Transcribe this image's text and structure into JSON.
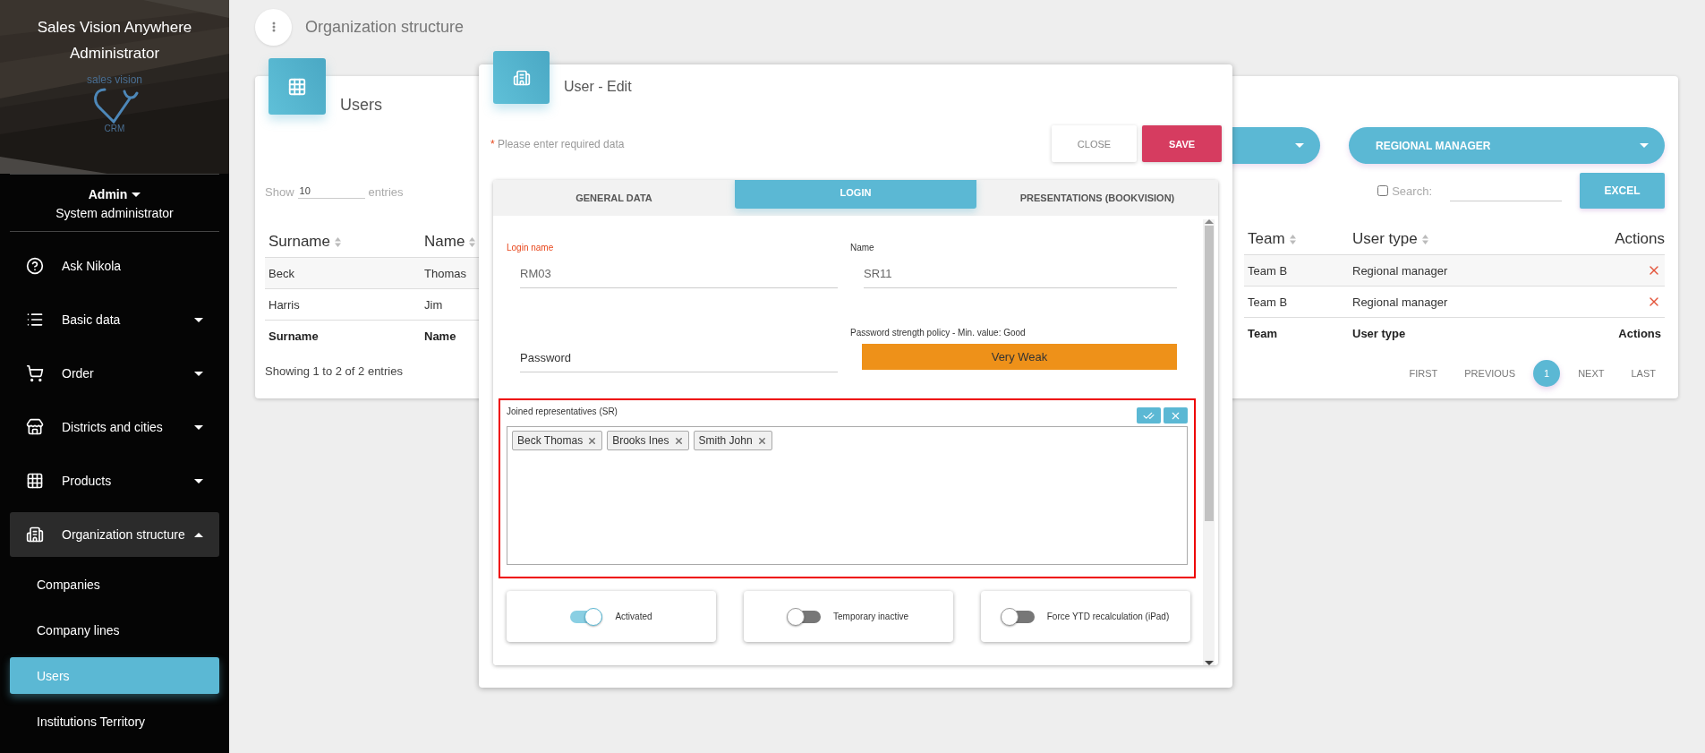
{
  "sidebar": {
    "app_title": "Sales Vision Anywhere Administrator",
    "logo": {
      "top": "sales vision",
      "bottom": "CRM"
    },
    "user": {
      "name": "Admin",
      "role": "System administrator"
    },
    "items": [
      {
        "label": "Ask Nikola",
        "kind": "link",
        "selected": false
      },
      {
        "label": "Basic data",
        "kind": "group",
        "expanded": false,
        "selected": false
      },
      {
        "label": "Order",
        "kind": "group",
        "expanded": false,
        "selected": false
      },
      {
        "label": "Districts and cities",
        "kind": "group",
        "expanded": false,
        "selected": false
      },
      {
        "label": "Products",
        "kind": "group",
        "expanded": false,
        "selected": false
      },
      {
        "label": "Organization structure",
        "kind": "group",
        "expanded": true,
        "selected": true,
        "children": [
          {
            "label": "Companies",
            "selected": false
          },
          {
            "label": "Company lines",
            "selected": false
          },
          {
            "label": "Users",
            "selected": true
          },
          {
            "label": "Institutions Territory",
            "selected": false
          }
        ]
      }
    ]
  },
  "page_title": "Organization structure",
  "users_card": {
    "title": "Users",
    "show_label": "Show",
    "entries_value": "10",
    "entries_label": "entries",
    "filter": {
      "value": "REGIONAL MANAGER"
    },
    "search": {
      "label": "Search:",
      "checked": false
    },
    "export_button": "EXCEL",
    "left_columns": [
      "Surname",
      "Name"
    ],
    "right_columns": [
      "Team",
      "User type",
      "Actions"
    ],
    "rows": [
      {
        "surname": "Beck",
        "name": "Thomas",
        "team": "Team B",
        "user_type": "Regional manager"
      },
      {
        "surname": "Harris",
        "name": "Jim",
        "team": "Team B",
        "user_type": "Regional manager"
      }
    ],
    "left_footer": [
      "Surname",
      "Name"
    ],
    "right_footer": [
      "Team",
      "User type",
      "Actions"
    ],
    "info": "Showing 1 to 2 of 2 entries",
    "pagination": [
      {
        "label": "FIRST",
        "selected": false
      },
      {
        "label": "PREVIOUS",
        "selected": false
      },
      {
        "label": "1",
        "selected": true
      },
      {
        "label": "NEXT",
        "selected": false
      },
      {
        "label": "LAST",
        "selected": false
      }
    ]
  },
  "dialog": {
    "title": "User - Edit",
    "required_mark": "*",
    "required_note": "Please enter required data",
    "buttons": [
      {
        "label": "CLOSE",
        "kind": "secondary"
      },
      {
        "label": "SAVE",
        "kind": "primary"
      }
    ],
    "tabs": [
      {
        "label": "GENERAL DATA",
        "selected": false
      },
      {
        "label": "LOGIN",
        "selected": true
      },
      {
        "label": "PRESENTATIONS (BOOKVISION)",
        "selected": false
      }
    ],
    "fields": [
      {
        "label": "Login name",
        "value": "RM03",
        "required": true
      },
      {
        "label": "Name",
        "value": "SR11",
        "required": false
      }
    ],
    "password": {
      "placeholder": "Password"
    },
    "strength": {
      "label": "Password strength policy - Min. value: Good",
      "value": "Very Weak"
    },
    "representatives": {
      "label": "Joined representatives (SR)",
      "highlighted": true,
      "tags": [
        "Beck Thomas",
        "Brooks Ines",
        "Smith John"
      ]
    },
    "toggles": [
      {
        "label": "Activated",
        "on": true
      },
      {
        "label": "Temporary inactive",
        "on": false
      },
      {
        "label": "Force YTD recalculation (iPad)",
        "on": false
      }
    ]
  }
}
